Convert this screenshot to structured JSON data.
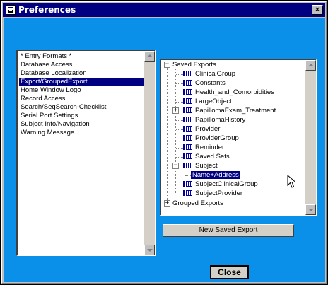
{
  "window": {
    "title": "Preferences",
    "close_glyph": "×"
  },
  "left_list": {
    "items": [
      "* Entry Formats *",
      "Database Access",
      "Database Localization",
      "Export/GroupedExport",
      "Home Window Logo",
      "Record Access",
      "Search/SeqSearch-Checklist",
      "Serial Port Settings",
      "Subject Info/Navigation",
      "Warning Message"
    ],
    "selected_index": 3
  },
  "tree": {
    "saved_exports": "Saved Exports",
    "grouped_exports": "Grouped Exports",
    "children": [
      "ClinicalGroup",
      "Constants",
      "Health_and_Comorbidities",
      "LargeObject",
      "PapillomaExam_Treatment",
      "PapillomaHistory",
      "Provider",
      "ProviderGroup",
      "Reminder",
      "Saved Sets",
      "Subject",
      "SubjectClinicalGroup",
      "SubjectProvider"
    ],
    "subject_child": "Name+Address",
    "expand_glyph": "+",
    "collapse_glyph": "−"
  },
  "buttons": {
    "new_saved_export": "New Saved Export",
    "close": "Close"
  },
  "colors": {
    "client_bg": "#0a90e8",
    "titlebar": "#000080",
    "selection": "#000080"
  },
  "icons": [
    "app-icon",
    "close-icon",
    "doc-icon",
    "mouse-pointer-icon"
  ]
}
